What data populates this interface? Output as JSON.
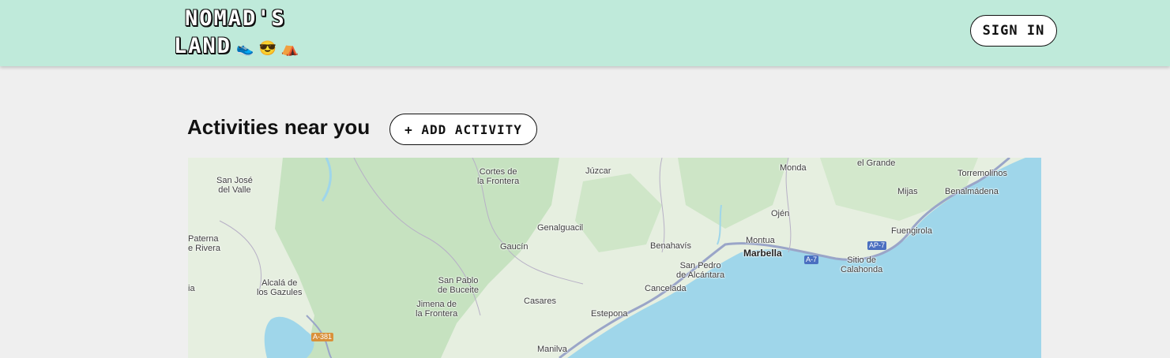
{
  "header": {
    "logo_line1": "NOMAD'S",
    "logo_line2": "LAND",
    "logo_emoji": "👟😎⛺",
    "signin_label": "SIGN IN"
  },
  "main": {
    "title": "Activities near you",
    "add_button_label": "+ ADD ACTIVITY"
  },
  "map": {
    "places": [
      {
        "name": "San José\ndel Valle"
      },
      {
        "name": "Cortes de\nla Frontera"
      },
      {
        "name": "Júzcar"
      },
      {
        "name": "Monda"
      },
      {
        "name": "el Grande"
      },
      {
        "name": "Torremolinos"
      },
      {
        "name": "Mijas"
      },
      {
        "name": "Benalmádena"
      },
      {
        "name": "Ojén"
      },
      {
        "name": "Genalguacil"
      },
      {
        "name": "Paterna\ne Rivera"
      },
      {
        "name": "Fuengirola"
      },
      {
        "name": "Gaucín"
      },
      {
        "name": "Benahavís"
      },
      {
        "name": "Montua"
      },
      {
        "name": "Marbella"
      },
      {
        "name": "Sitio de\nCalahonda"
      },
      {
        "name": "San Pedro\nde Alcántara"
      },
      {
        "name": "ia"
      },
      {
        "name": "Alcalá de\nlos Gazules"
      },
      {
        "name": "San Pablo\nde Buceite"
      },
      {
        "name": "Cancelada"
      },
      {
        "name": "Jimena de\nla Frontera"
      },
      {
        "name": "Casares"
      },
      {
        "name": "Estepona"
      },
      {
        "name": "Manilva"
      }
    ],
    "shields": [
      {
        "label": "AP-7",
        "color": "blue"
      },
      {
        "label": "A-7",
        "color": "blue"
      },
      {
        "label": "A-381",
        "color": "orange"
      }
    ]
  },
  "colors": {
    "header_bg": "#bfeada",
    "page_bg": "#efefef",
    "sea": "#9fd6ea",
    "land": "#e6efe0",
    "forest": "#c9e3c4"
  }
}
